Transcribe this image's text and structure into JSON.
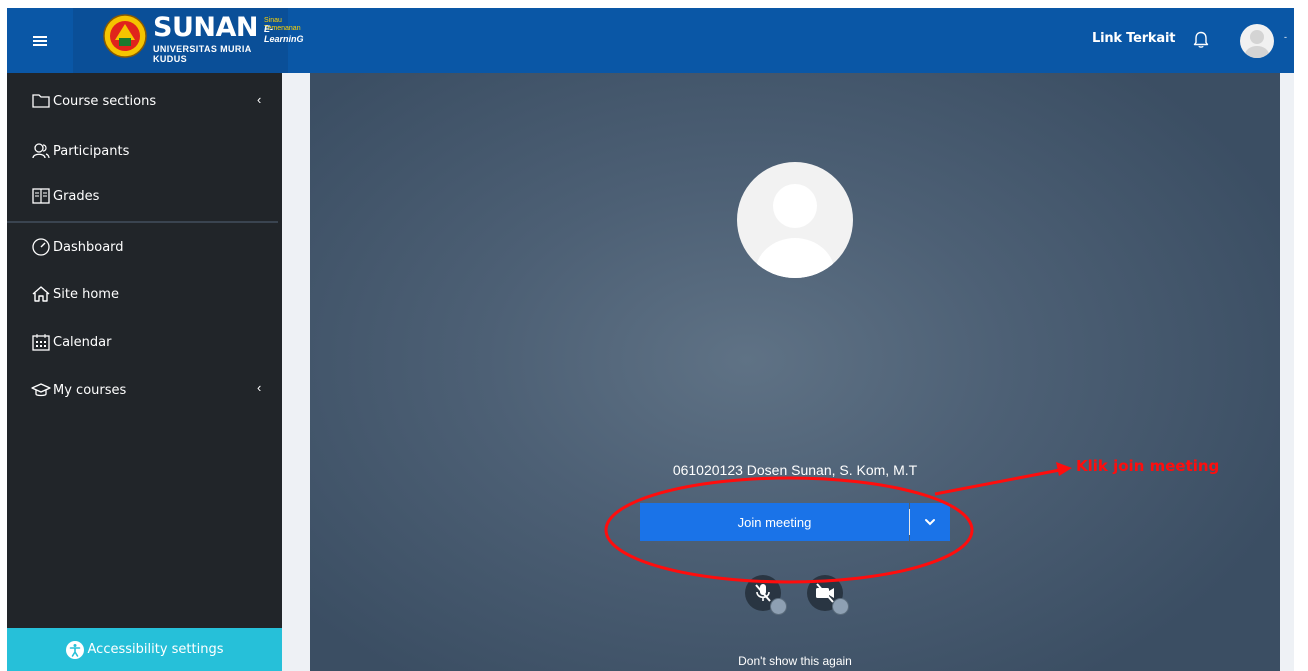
{
  "header": {
    "brand_name": "SUNAN",
    "brand_tagline": "Sinau Temenanan",
    "brand_elearning": "E-LearninG",
    "university": "UNIVERSITAS MURIA KUDUS",
    "link_terkait": "Link Terkait",
    "icons": [
      "hamburger-icon",
      "bell-icon",
      "user-avatar-icon"
    ]
  },
  "sidebar": {
    "items": [
      {
        "label": "Course sections",
        "icon": "folder-icon",
        "has_chevron": true
      },
      {
        "label": "Participants",
        "icon": "users-icon",
        "has_chevron": false
      },
      {
        "label": "Grades",
        "icon": "grades-book-icon",
        "has_chevron": false
      },
      {
        "label": "Dashboard",
        "icon": "dashboard-gauge-icon",
        "has_chevron": false
      },
      {
        "label": "Site home",
        "icon": "home-icon",
        "has_chevron": false
      },
      {
        "label": "Calendar",
        "icon": "calendar-icon",
        "has_chevron": false
      },
      {
        "label": "My courses",
        "icon": "graduation-cap-icon",
        "has_chevron": true
      }
    ],
    "chevron": "‹",
    "accessibility_label": "Accessibility settings"
  },
  "meeting": {
    "display_name": "061020123 Dosen Sunan, S. Kom, M.T",
    "join_label": "Join meeting",
    "dont_show": "Don't show this again",
    "mic_state": "muted",
    "camera_state": "off"
  },
  "annotation": {
    "text": "Klik join meeting",
    "color": "#ff0d0d"
  },
  "colors": {
    "navbar": "#0a57a6",
    "sidebar": "#212529",
    "accessibility": "#26c0d9",
    "join_button": "#1a73e8"
  }
}
